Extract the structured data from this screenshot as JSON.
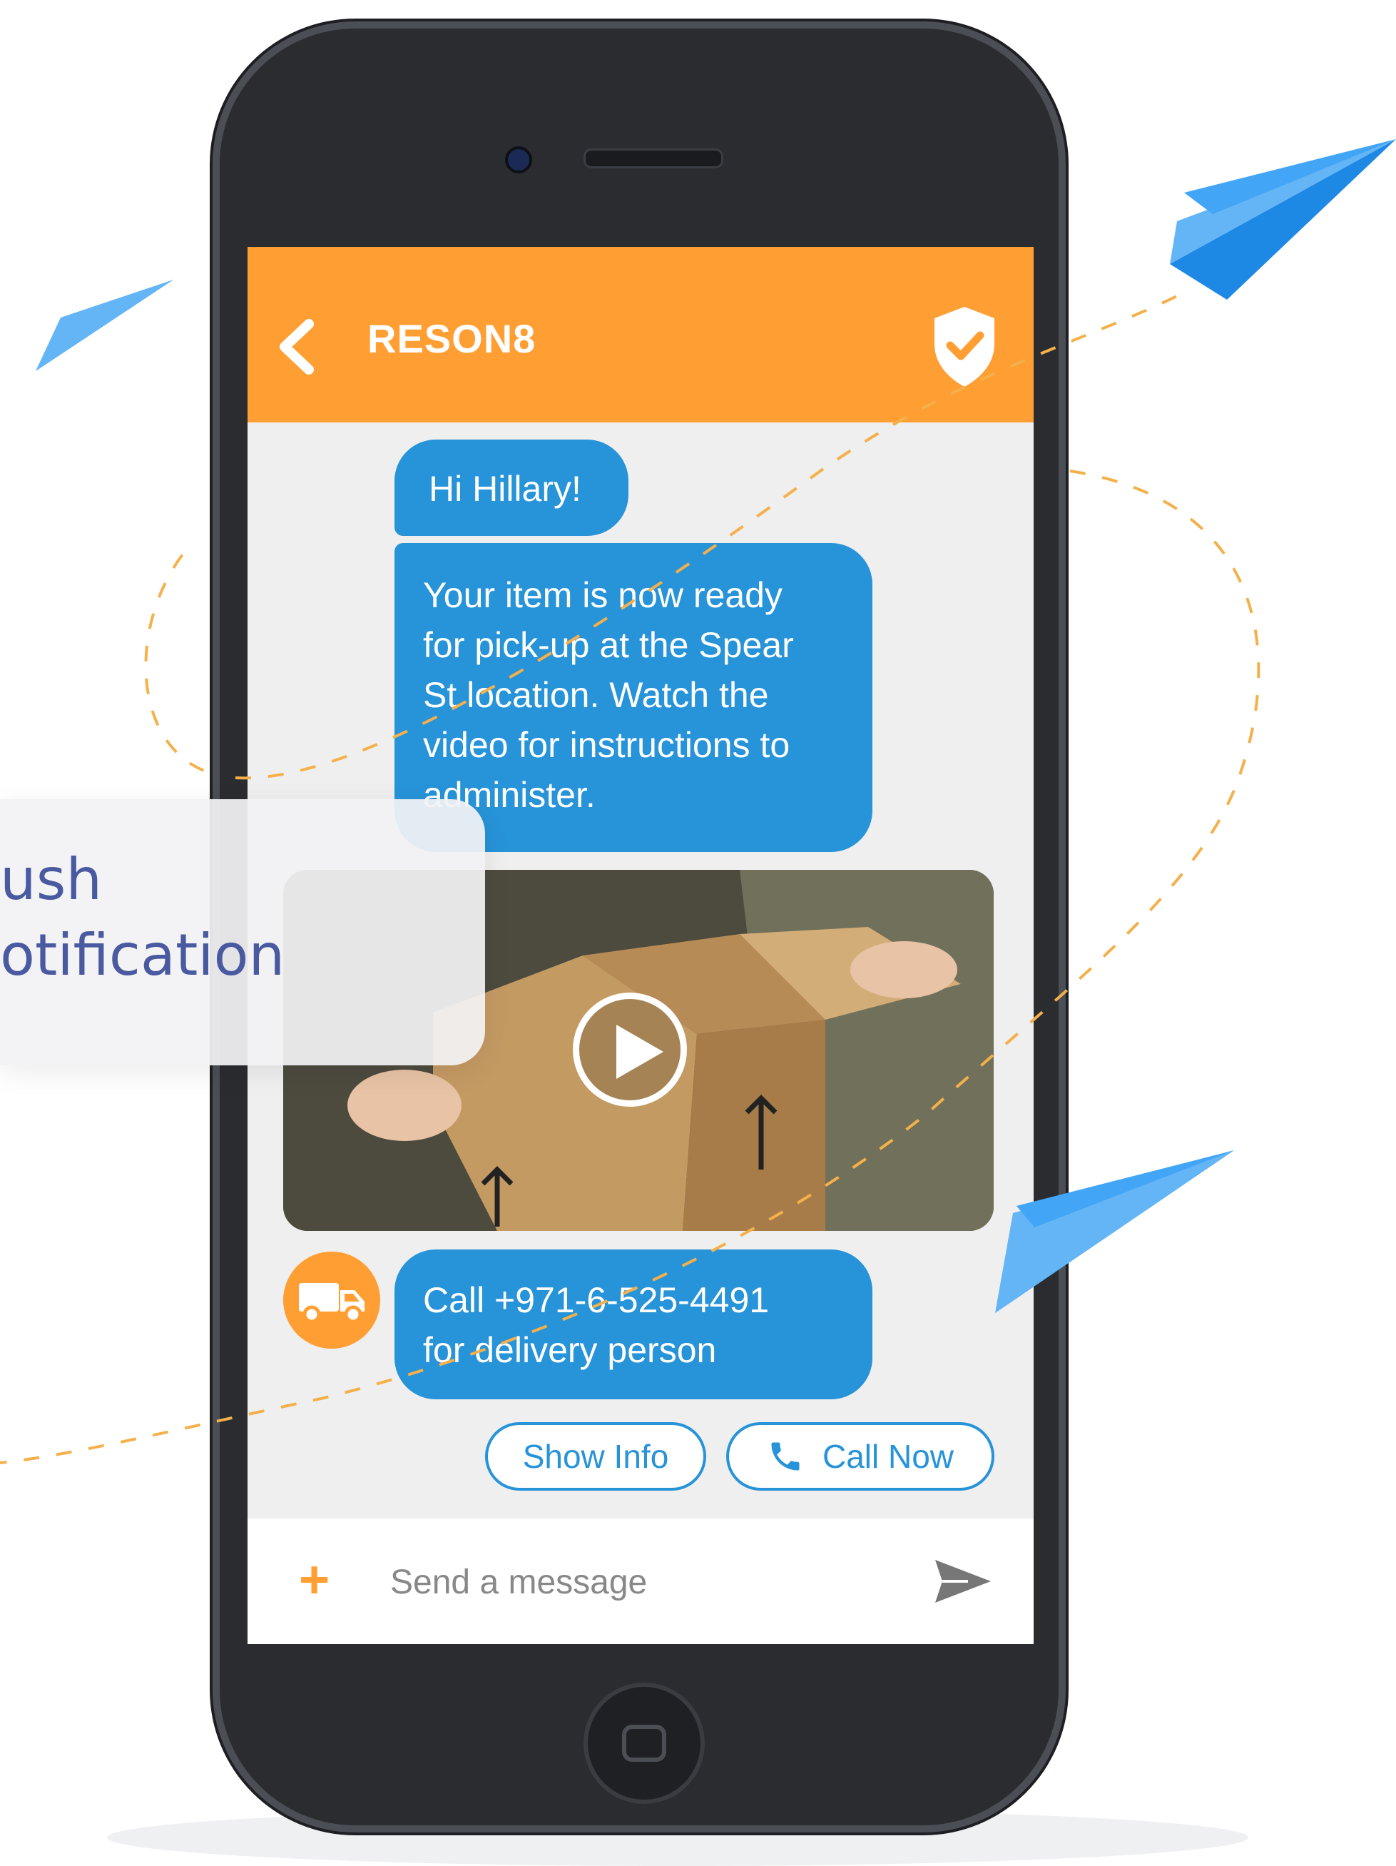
{
  "app": {
    "title": "RESON8"
  },
  "messages": {
    "greeting": "Hi Hillary!",
    "notice_lines": [
      "Your item is now ready",
      "for pick-up at the Spear",
      "St location. Watch the",
      "video for instructions to",
      "administer."
    ],
    "delivery_lines": [
      "Call +971-6-525-4491",
      "for delivery person"
    ]
  },
  "actions": {
    "show_info": "Show Info",
    "call_now": "Call Now"
  },
  "composer": {
    "placeholder": "Send a message"
  },
  "push_card": {
    "line1": "ush",
    "line2": "otification"
  },
  "colors": {
    "brand_orange": "#ff9f33",
    "bubble_blue": "#2793d8",
    "phone_body": "#2a2c30",
    "plane_blue": "#2196f3",
    "dash_orange": "#f4b04a"
  },
  "icons": [
    "chevron-left-icon",
    "shield-check-icon",
    "play-icon",
    "truck-icon",
    "phone-icon",
    "plus-icon",
    "send-icon",
    "paper-plane-icon"
  ]
}
